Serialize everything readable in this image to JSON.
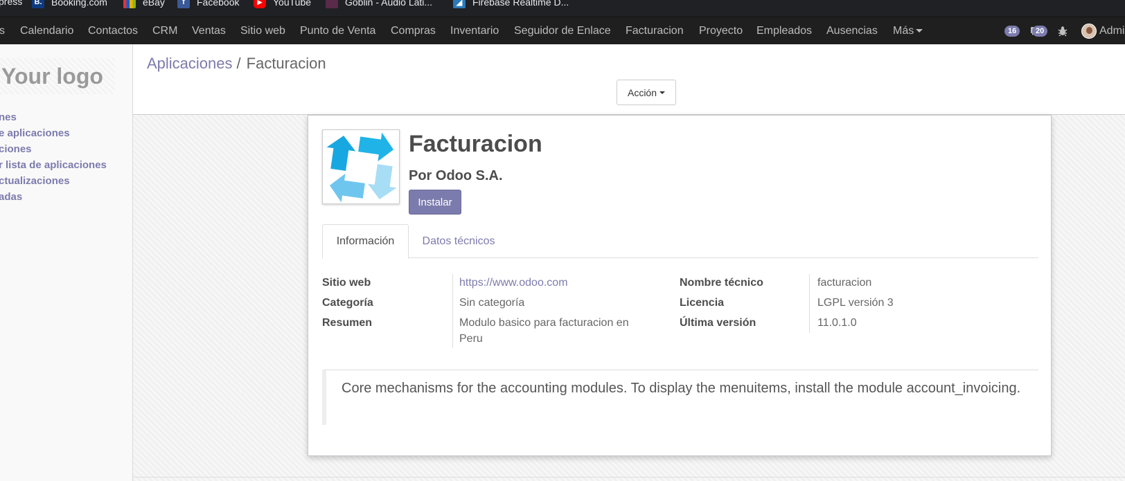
{
  "bookmarks": [
    {
      "label": "press",
      "icon": "wordpress-icon"
    },
    {
      "label": "Booking.com",
      "icon": "booking-icon"
    },
    {
      "label": "eBay",
      "icon": "ebay-icon"
    },
    {
      "label": "Facebook",
      "icon": "facebook-icon"
    },
    {
      "label": "YouTube",
      "icon": "youtube-icon"
    },
    {
      "label": "Goblin - Audio Lati...",
      "icon": "goblin-icon"
    },
    {
      "label": "Firebase Realtime D...",
      "icon": "firebase-icon"
    }
  ],
  "nav": {
    "items": [
      "s",
      "Calendario",
      "Contactos",
      "CRM",
      "Ventas",
      "Sitio web",
      "Punto de Venta",
      "Compras",
      "Inventario",
      "Seguidor de Enlace",
      "Facturacion",
      "Proyecto",
      "Empleados",
      "Ausencias"
    ],
    "more_label": "Más",
    "activity_count": "16",
    "messages_count": "20",
    "user_label": "Admi"
  },
  "sidebar": {
    "logo_text": "Your logo",
    "links": [
      "nes",
      "e aplicaciones",
      "ciones",
      "r lista de aplicaciones",
      "ctualizaciones",
      "adas"
    ]
  },
  "breadcrumb": {
    "parent": "Aplicaciones",
    "separator": "/",
    "current": "Facturacion"
  },
  "action_button": "Acción",
  "module": {
    "name": "Facturacion",
    "author": "Por Odoo S.A.",
    "install_label": "Instalar",
    "tabs": [
      "Información",
      "Datos técnicos"
    ],
    "fields_left": [
      {
        "label": "Sitio web",
        "value": "https://www.odoo.com"
      },
      {
        "label": "Categoría",
        "value": "Sin categoría"
      },
      {
        "label": "Resumen",
        "value": "Modulo basico para facturacion en Peru"
      }
    ],
    "fields_right": [
      {
        "label": "Nombre técnico",
        "value": "facturacion"
      },
      {
        "label": "Licencia",
        "value": "LGPL versión 3"
      },
      {
        "label": "Última versión",
        "value": "11.0.1.0"
      }
    ],
    "description": "Core mechanisms for the accounting modules. To display the menuitems, install the module account_invoicing."
  },
  "colors": {
    "brand": "#7c7bad",
    "nav_bg": "#1f1f1f",
    "icon_blue": "#1fb3e8",
    "icon_light": "#9fd9f5"
  }
}
